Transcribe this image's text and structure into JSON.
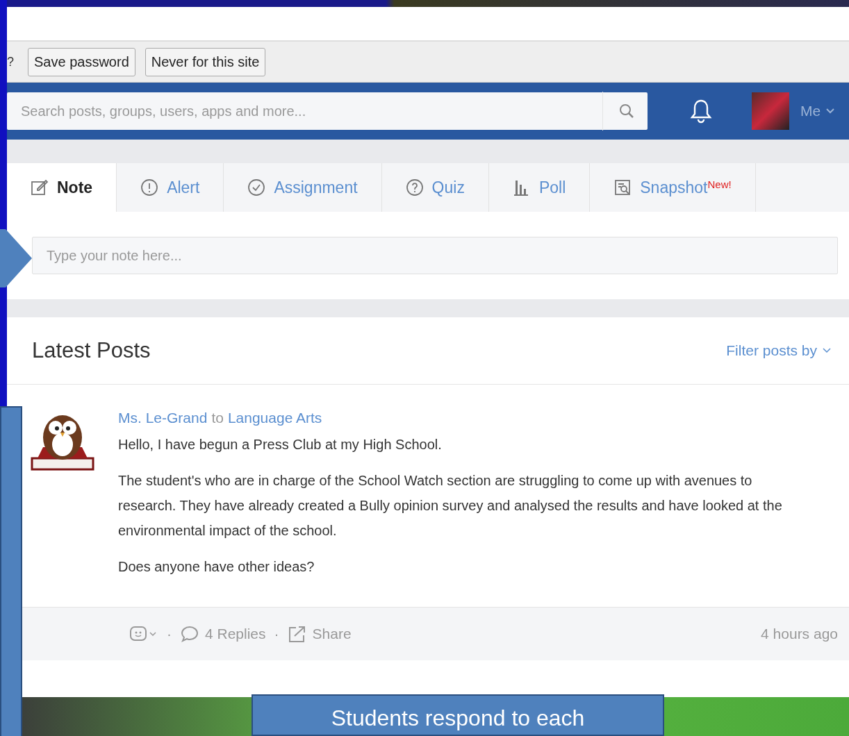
{
  "password_bar": {
    "prompt": "?",
    "buttons": [
      "Save password",
      "Never for this site"
    ]
  },
  "nav": {
    "search": {
      "placeholder": "Search posts, groups, users, apps and more..."
    },
    "user": "Me"
  },
  "composer": {
    "tabs": [
      {
        "label": "Note",
        "kind": "note",
        "selected": true
      },
      {
        "label": "Alert",
        "kind": "alert",
        "selected": false
      },
      {
        "label": "Assignment",
        "kind": "assignment",
        "selected": false
      },
      {
        "label": "Quiz",
        "kind": "quiz",
        "selected": false
      },
      {
        "label": "Poll",
        "kind": "poll",
        "selected": false
      },
      {
        "label": "Snapshot",
        "kind": "snapshot",
        "selected": false,
        "badge": "New!"
      }
    ],
    "placeholder": "Type your note here..."
  },
  "feed": {
    "title": "Latest Posts",
    "filter": "Filter posts by",
    "post": {
      "author": "Ms. Le-Grand",
      "connector": "to",
      "group": "Language Arts",
      "paragraphs": [
        "Hello, I have begun a Press Club at my High School.",
        "The student's who are in charge of the School Watch section are struggling to come up with avenues to research. They have already created a Bully opinion survey and analysed the results and have looked at the environmental impact of the school.",
        "Does anyone have other ideas?"
      ],
      "separators": [
        "·",
        "·"
      ],
      "replies": "4 Replies",
      "share": "Share",
      "time": "4 hours ago"
    }
  },
  "callout": "Students respond to each"
}
